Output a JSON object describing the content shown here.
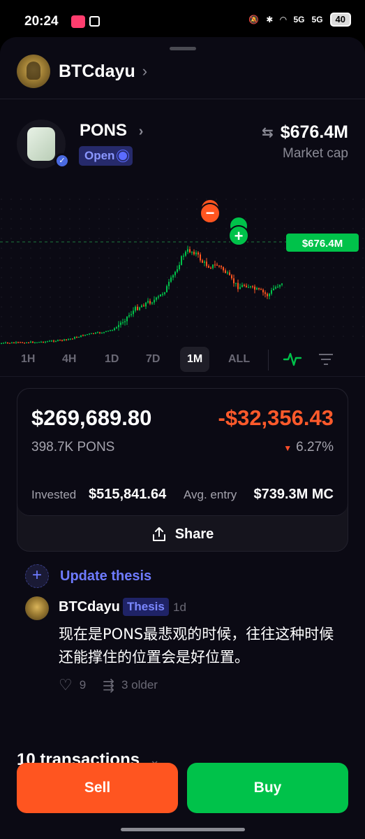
{
  "status_bar": {
    "time": "20:24",
    "battery": "40",
    "network_1": "5G",
    "network_2": "5G"
  },
  "owner": {
    "name": "BTCdayu"
  },
  "token": {
    "name": "PONS",
    "status_badge": "Open",
    "market_cap": "$676.4M",
    "market_cap_label": "Market cap"
  },
  "chart": {
    "price_tag": "$676.4M",
    "sell_marker": "−",
    "buy_marker": "+"
  },
  "timeframes": [
    "1H",
    "4H",
    "1D",
    "7D",
    "1M",
    "ALL"
  ],
  "active_timeframe": "1M",
  "position": {
    "value": "$269,689.80",
    "pnl": "-$32,356.43",
    "quantity": "398.7K PONS",
    "pnl_percent": "6.27%",
    "invested_label": "Invested",
    "invested_value": "$515,841.64",
    "avg_entry_label": "Avg. entry",
    "avg_entry_value": "$739.3M MC",
    "share_label": "Share"
  },
  "thesis": {
    "update_label": "Update thesis",
    "author": "BTCdayu",
    "tag": "Thesis",
    "age": "1d",
    "body": "现在是PONS最悲观的时候，往往这种时候还能撑住的位置会是好位置。",
    "likes": "9",
    "older_label": "3 older"
  },
  "transactions_label": "10 transactions",
  "actions": {
    "sell": "Sell",
    "buy": "Buy"
  },
  "colors": {
    "up": "#00c24a",
    "down": "#ff5520",
    "accent": "#6e7bff"
  }
}
